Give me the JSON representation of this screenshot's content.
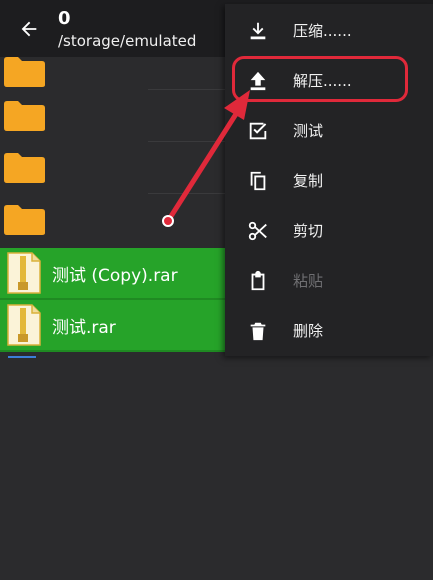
{
  "header": {
    "selected_count": "0",
    "path": "/storage/emulated"
  },
  "files": [
    {
      "name": "测试 (Copy).rar"
    },
    {
      "name": "测试.rar"
    }
  ],
  "menu": {
    "items": [
      {
        "label": "压缩......",
        "icon": "download-icon",
        "enabled": true
      },
      {
        "label": "解压......",
        "icon": "upload-icon",
        "enabled": true
      },
      {
        "label": "测试",
        "icon": "check-box-icon",
        "enabled": true
      },
      {
        "label": "复制",
        "icon": "copy-icon",
        "enabled": true
      },
      {
        "label": "剪切",
        "icon": "scissors-icon",
        "enabled": true
      },
      {
        "label": "粘贴",
        "icon": "clipboard-icon",
        "enabled": false
      },
      {
        "label": "删除",
        "icon": "trash-icon",
        "enabled": true
      }
    ]
  },
  "colors": {
    "selection": "#26a329",
    "annotation": "#e0293a",
    "folder": "#f5a623"
  }
}
